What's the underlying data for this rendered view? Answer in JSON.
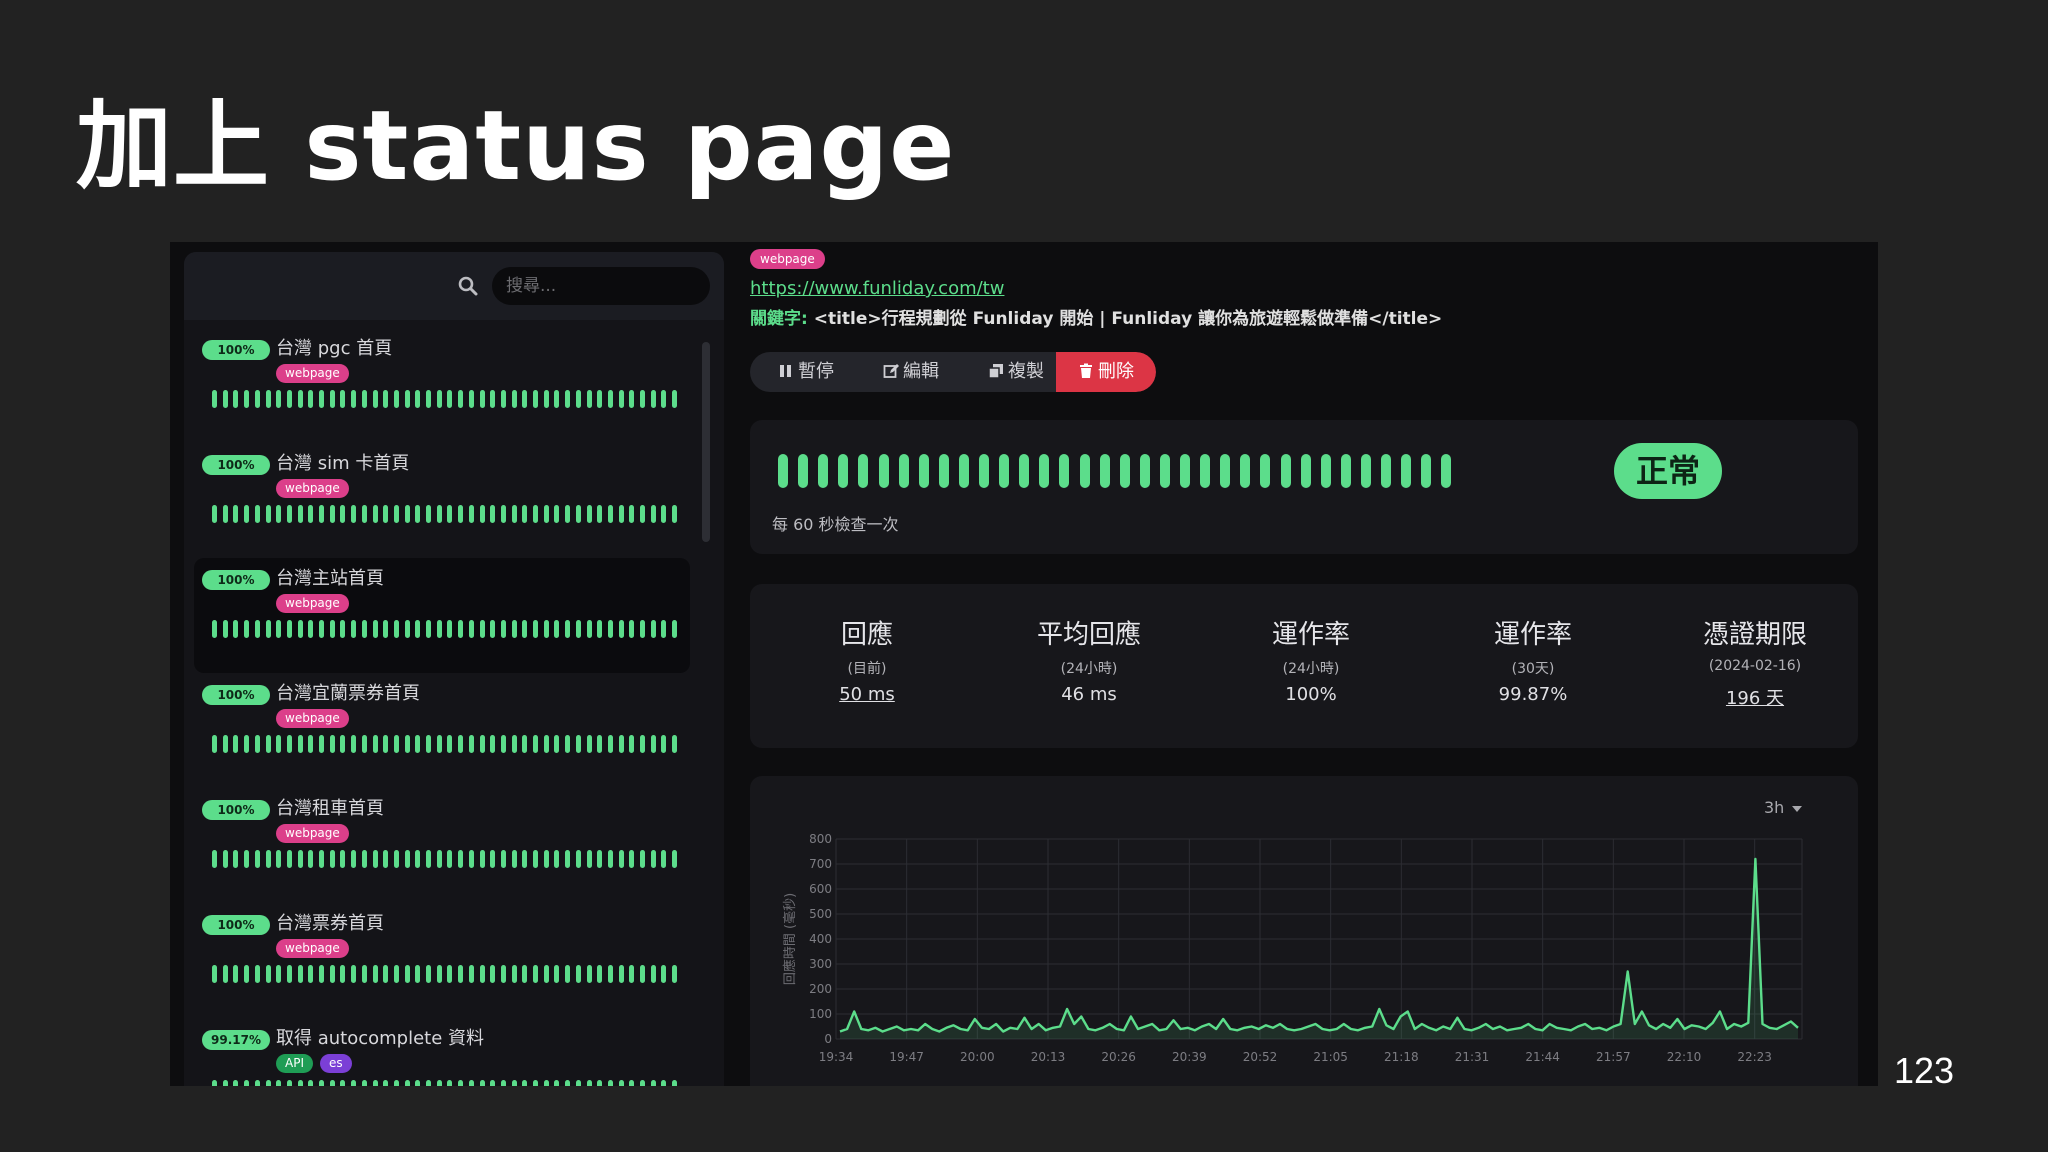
{
  "slide": {
    "title": "加上 status page",
    "page_number": "123"
  },
  "search": {
    "placeholder": "搜尋..."
  },
  "colors": {
    "up": "#5cdd8b",
    "webpage_tag": "#dc3f8a",
    "api_tag": "#1f9d55",
    "extra_tag": "#7b3fd6",
    "delete": "#dc3545"
  },
  "monitors": [
    {
      "uptime": "100%",
      "name": "台灣 pgc 首頁",
      "tags": [
        {
          "label": "webpage",
          "color": "#dc3f8a"
        }
      ],
      "beats_up": 44
    },
    {
      "uptime": "100%",
      "name": "台灣 sim 卡首頁",
      "tags": [
        {
          "label": "webpage",
          "color": "#dc3f8a"
        }
      ],
      "beats_up": 44
    },
    {
      "uptime": "100%",
      "name": "台灣主站首頁",
      "tags": [
        {
          "label": "webpage",
          "color": "#dc3f8a"
        }
      ],
      "beats_up": 44,
      "active": true
    },
    {
      "uptime": "100%",
      "name": "台灣宜蘭票券首頁",
      "tags": [
        {
          "label": "webpage",
          "color": "#dc3f8a"
        }
      ],
      "beats_up": 44
    },
    {
      "uptime": "100%",
      "name": "台灣租車首頁",
      "tags": [
        {
          "label": "webpage",
          "color": "#dc3f8a"
        }
      ],
      "beats_up": 44
    },
    {
      "uptime": "100%",
      "name": "台灣票券首頁",
      "tags": [
        {
          "label": "webpage",
          "color": "#dc3f8a"
        }
      ],
      "beats_up": 44
    },
    {
      "uptime": "99.17%",
      "name": "取得 autocomplete 資料",
      "tags": [
        {
          "label": "API",
          "color": "#1f9d55"
        },
        {
          "label": "es",
          "color": "#7b3fd6"
        }
      ],
      "beats_up": 44
    }
  ],
  "detail": {
    "type_badge": "webpage",
    "url": "https://www.funliday.com/tw",
    "keyword_label": "關鍵字:",
    "keyword_value": "<title>行程規劃從 Funliday 開始 | Funliday 讓你為旅遊輕鬆做準備</title>",
    "actions": {
      "pause": "暫停",
      "edit": "編輯",
      "clone": "複製",
      "delete": "刪除"
    },
    "status": "正常",
    "check_interval": "每 60 秒檢查一次",
    "status_beats": 34,
    "stats": [
      {
        "title": "回應",
        "sub": "(目前)",
        "value": "50 ms",
        "link": true
      },
      {
        "title": "平均回應",
        "sub": "(24小時)",
        "value": "46 ms",
        "link": false
      },
      {
        "title": "運作率",
        "sub": "(24小時)",
        "value": "100%",
        "link": false
      },
      {
        "title": "運作率",
        "sub": "(30天)",
        "value": "99.87%",
        "link": false
      },
      {
        "title": "憑證期限",
        "sub": "(2024-02-16)",
        "value": "196 天",
        "link": true
      }
    ],
    "range": "3h"
  },
  "chart_data": {
    "type": "line",
    "ylabel": "回應時間 (毫秒)",
    "ylim": [
      0,
      800
    ],
    "y_ticks": [
      0,
      100,
      200,
      300,
      400,
      500,
      600,
      700,
      800
    ],
    "x_ticks": [
      "19:34",
      "19:47",
      "20:00",
      "20:13",
      "20:26",
      "20:39",
      "20:52",
      "21:05",
      "21:18",
      "21:31",
      "21:44",
      "21:57",
      "22:10",
      "22:23"
    ],
    "grid": true,
    "series": [
      {
        "color": "#5cdd8b",
        "values": [
          30,
          40,
          110,
          40,
          35,
          45,
          30,
          40,
          50,
          35,
          40,
          35,
          60,
          40,
          30,
          45,
          55,
          40,
          35,
          80,
          45,
          40,
          60,
          30,
          45,
          40,
          85,
          40,
          60,
          35,
          45,
          50,
          120,
          60,
          90,
          40,
          35,
          45,
          60,
          40,
          35,
          90,
          40,
          50,
          60,
          35,
          40,
          75,
          40,
          45,
          35,
          50,
          60,
          40,
          80,
          40,
          35,
          45,
          50,
          40,
          55,
          45,
          60,
          40,
          35,
          40,
          50,
          60,
          40,
          35,
          40,
          60,
          40,
          35,
          45,
          50,
          120,
          55,
          40,
          90,
          110,
          40,
          60,
          45,
          35,
          50,
          40,
          85,
          40,
          35,
          45,
          60,
          40,
          50,
          35,
          40,
          45,
          60,
          40,
          35,
          60,
          45,
          40,
          35,
          50,
          60,
          40,
          45,
          35,
          50,
          60,
          270,
          60,
          110,
          55,
          40,
          60,
          45,
          80,
          40,
          55,
          50,
          40,
          65,
          110,
          40,
          60,
          50,
          65,
          720,
          60,
          45,
          40,
          55,
          70,
          45
        ]
      }
    ]
  }
}
